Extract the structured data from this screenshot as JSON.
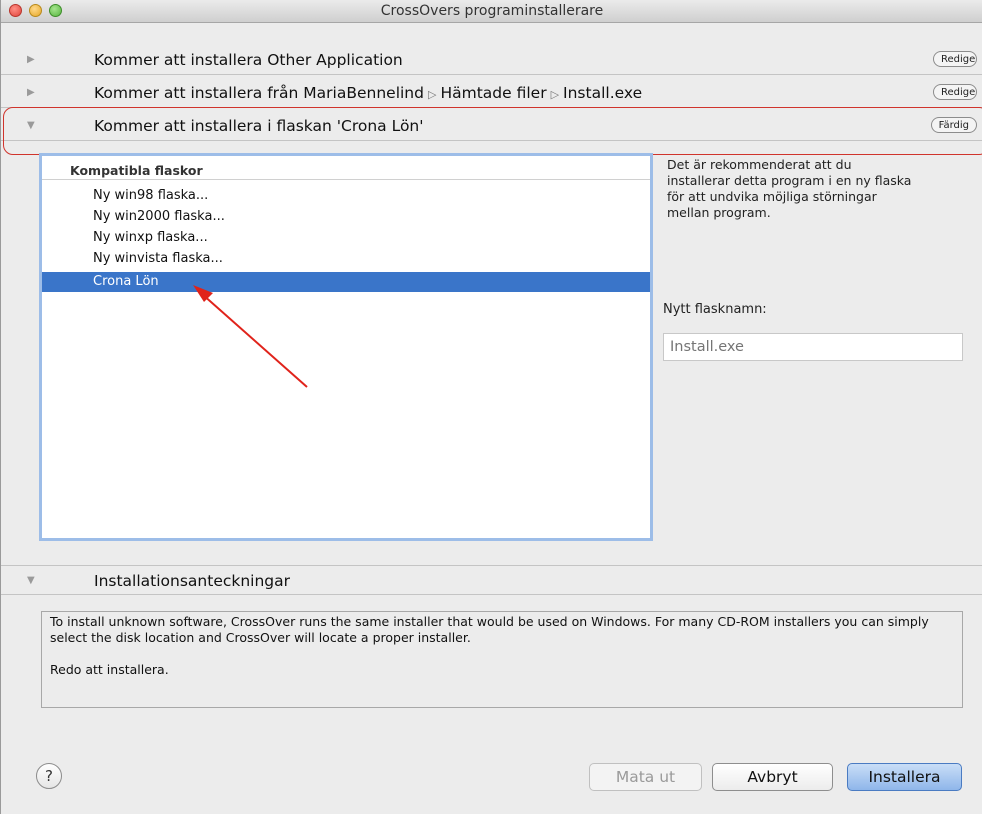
{
  "window": {
    "title": "CrossOvers programinstallerare"
  },
  "sections": [
    {
      "label": "Kommer att installera Other Application",
      "button": "Redigera",
      "expanded": false
    },
    {
      "path": [
        "Kommer att installera från MariaBennelind",
        "Hämtade filer",
        "Install.exe"
      ],
      "button": "Redigera",
      "expanded": false
    },
    {
      "label": "Kommer att installera i flaskan 'Crona Lön'",
      "button": "Färdig",
      "expanded": true
    }
  ],
  "bottles": {
    "header": "Kompatibla flaskor",
    "items": [
      "Ny win98 flaska...",
      "Ny win2000 flaska...",
      "Ny winxp flaska...",
      "Ny winvista flaska...",
      "Crona Lön"
    ],
    "selected": "Crona Lön"
  },
  "description": "Det är rekommenderat att du installerar detta program i en ny flaska för att undvika möjliga störningar mellan program.",
  "new_bottle": {
    "label": "Nytt flasknamn:",
    "placeholder": "Install.exe"
  },
  "notes": {
    "title": "Installationsanteckningar",
    "text1": "To install unknown software, CrossOver runs the same installer that would be used on Windows. For many CD-ROM installers you can simply select the disk location and CrossOver will locate a proper installer.",
    "text2": "Redo att installera."
  },
  "buttons": {
    "help": "?",
    "eject": "Mata ut",
    "cancel": "Avbryt",
    "install": "Installera"
  },
  "colors": {
    "selection": "#3a75c9",
    "highlight_annotation": "#d0342c",
    "focus_ring": "#9dbde8"
  }
}
